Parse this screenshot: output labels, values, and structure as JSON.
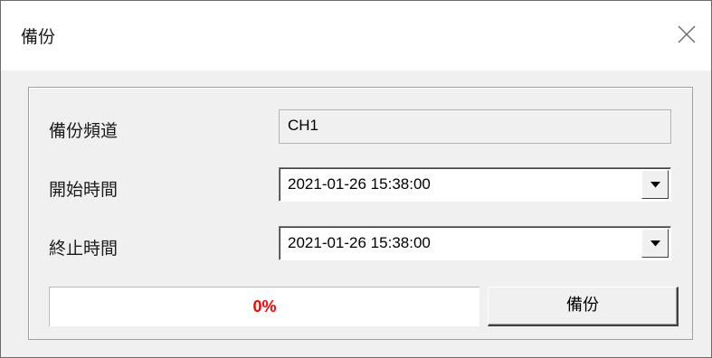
{
  "window": {
    "title": "備份"
  },
  "form": {
    "channel": {
      "label": "備份頻道",
      "value": "CH1"
    },
    "start_time": {
      "label": "開始時間",
      "value": "2021-01-26 15:38:00"
    },
    "end_time": {
      "label": "終止時間",
      "value": "2021-01-26 15:38:00"
    }
  },
  "progress": {
    "text": "0%",
    "value": 0,
    "text_color": "#ff0000"
  },
  "actions": {
    "backup_label": "備份"
  }
}
